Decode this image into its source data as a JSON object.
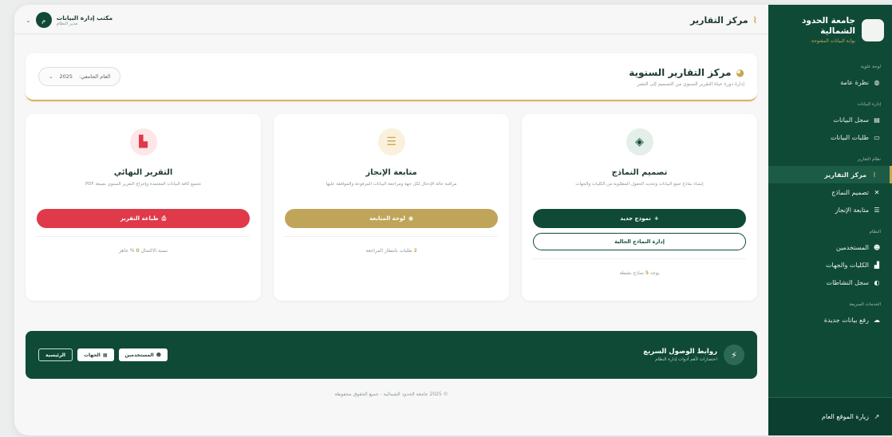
{
  "sidebar": {
    "brand_name": "جامعة الحدود الشمالية",
    "brand_sub": "بوابة البيانات المفتوحة",
    "sections": [
      {
        "title": "لوحة علوية",
        "items": [
          {
            "label": "نظرة عامة",
            "icon": "globe-icon",
            "glyph": "◍",
            "active": false
          }
        ]
      },
      {
        "title": "إدارة البيانات",
        "items": [
          {
            "label": "سجل البيانات",
            "icon": "database-icon",
            "glyph": "▤",
            "active": false
          },
          {
            "label": "طلبات البيانات",
            "icon": "laptop-icon",
            "glyph": "▭",
            "active": false
          }
        ]
      },
      {
        "title": "نظام التقارير",
        "items": [
          {
            "label": "مركز التقارير",
            "icon": "chart-icon",
            "glyph": "⌇",
            "active": true
          },
          {
            "label": "تصميم النماذج",
            "icon": "tools-icon",
            "glyph": "✕",
            "active": false
          },
          {
            "label": "متابعة الإنجاز",
            "icon": "checklist-icon",
            "glyph": "☰",
            "active": false
          }
        ]
      },
      {
        "title": "النظام",
        "items": [
          {
            "label": "المستخدمين",
            "icon": "users-icon",
            "glyph": "☻",
            "active": false
          },
          {
            "label": "الكليات والجهات",
            "icon": "building-icon",
            "glyph": "▟",
            "active": false
          },
          {
            "label": "سجل النشاطات",
            "icon": "history-icon",
            "glyph": "◐",
            "active": false
          }
        ]
      },
      {
        "title": "الخدمات السريعة",
        "items": [
          {
            "label": "رفع بيانات جديدة",
            "icon": "upload-icon",
            "glyph": "☁",
            "active": false
          }
        ]
      }
    ],
    "footer_label": "زيارة الموقع العام",
    "footer_icon_glyph": "↗"
  },
  "topbar": {
    "title": "مركز التقارير",
    "title_glyph": "⌇",
    "user_name": "مكتب إدارة البيانات",
    "user_role": "مدير النظام",
    "avatar_letter": "م",
    "chevron_glyph": "⌄"
  },
  "header": {
    "title": "مركز التقارير السنوية",
    "title_glyph": "◕",
    "subtitle": "إدارة دورة حياة التقرير السنوي من التصميم إلى النشر",
    "year_label": "العام الجامعي:",
    "year_value": "2025",
    "year_chevron": "⌄"
  },
  "cards": [
    {
      "key": "design",
      "title": "تصميم النماذج",
      "description": "إنشاء نماذج جمع البيانات وتحديد الحقول المطلوبة من الكليات والجهات",
      "icon_glyph": "◈",
      "icon_color": "#0f4a37",
      "icon_bg": "#e4efe9",
      "button_label": "نموذج جديد",
      "button_glyph": "+",
      "button_color": "#0f4a37",
      "secondary_label": "إدارة النماذج الحالية",
      "stat_prefix": "يوجد",
      "stat_value": "5",
      "stat_suffix": "نماذج نشطة",
      "stat_color": "#c9a74e"
    },
    {
      "key": "progress",
      "title": "متابعة الإنجاز",
      "description": "مراقبة حالة الإدخال لكل جهة ومراجعة البيانات المرفوعة والموافقة عليها",
      "icon_glyph": "☰",
      "icon_color": "#c9a74e",
      "icon_bg": "#f9f1dc",
      "button_label": "لوحة المتابعة",
      "button_glyph": "◉",
      "button_color": "#c0a45a",
      "stat_prefix": "",
      "stat_value": "2",
      "stat_suffix": "طلبات بانتظار المراجعة",
      "stat_color": "#c9a74e"
    },
    {
      "key": "final",
      "title": "التقرير النهائي",
      "description": "تجميع كافة البيانات المعتمدة وإخراج التقرير السنوي بصيغة PDF",
      "icon_glyph": "▙",
      "icon_color": "#e0394a",
      "icon_bg": "#fde6e8",
      "button_label": "طباعة التقرير",
      "button_glyph": "⎙",
      "button_color": "#e0394a",
      "stat_prefix": "نسبة الاكتمال",
      "stat_value": "0",
      "stat_suffix": "% جاهز",
      "stat_color": "#c9a74e"
    }
  ],
  "quick": {
    "title": "روابط الوصول السريع",
    "subtitle": "اختصارات لأهم أدوات إدارة النظام",
    "bolt_glyph": "⚡",
    "links": [
      {
        "label": "المستخدمين",
        "glyph": "☻",
        "ghost": false
      },
      {
        "label": "الجهات",
        "glyph": "▦",
        "ghost": false
      },
      {
        "label": "الرئيسية",
        "glyph": "",
        "ghost": true
      }
    ]
  },
  "footer": {
    "copyright": "© 2025 جامعة الحدود الشمالية - جميع الحقوق محفوظة"
  }
}
